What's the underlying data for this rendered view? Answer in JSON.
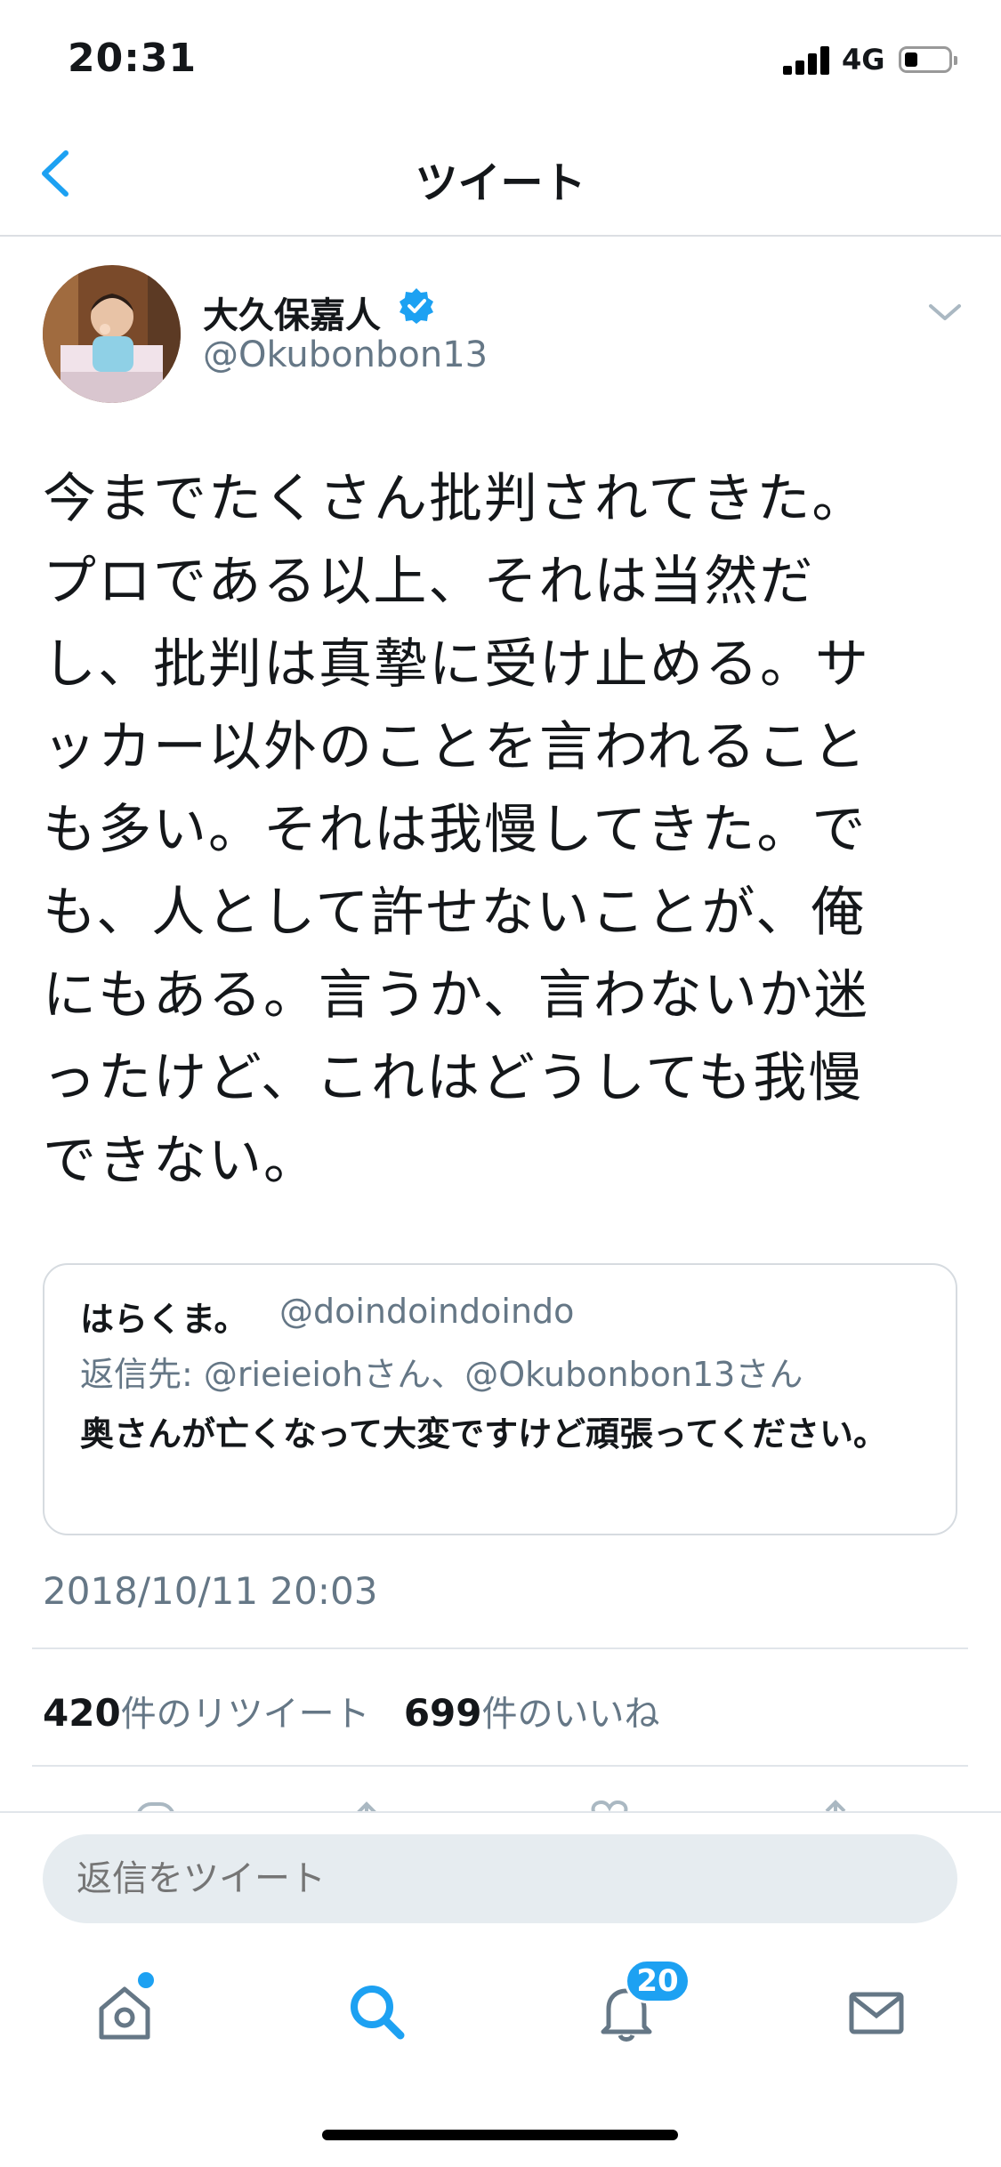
{
  "status_bar": {
    "time": "20:31",
    "network": "4G",
    "battery_level": 0.25
  },
  "nav": {
    "title": "ツイート",
    "back_icon": "chevron-left-icon"
  },
  "author": {
    "name": "大久保嘉人",
    "handle": "@Okubonbon13",
    "verified": true
  },
  "tweet": {
    "text": "今までたくさん批判されてきた。\nプロである以上、それは当然だ\nし、批判は真摯に受け止める。サ\nッカー以外のことを言われること\nも多い。それは我慢してきた。で\nも、人として許せないことが、俺\nにもある。言うか、言わないか迷\nったけど、これはどうしても我慢\nできない。",
    "timestamp": "2018/10/11 20:03"
  },
  "quoted": {
    "name": "はらくま。",
    "handle": "@doindoindoindo",
    "reply_to": "返信先: @rieieiohさん、@Okubonbon13さん",
    "text": "奥さんが亡くなって大変ですけど頑張ってください。"
  },
  "stats": {
    "retweets_count": "420",
    "retweets_label": "件のリツイート",
    "likes_count": "699",
    "likes_label": "件のいいね"
  },
  "reply": {
    "placeholder": "返信をツイート"
  },
  "tab_bar": {
    "items": [
      "home-icon",
      "search-icon",
      "bell-icon",
      "mail-icon"
    ],
    "notifications_badge": "20"
  },
  "colors": {
    "accent": "#1da1f2",
    "secondary_text": "#657786"
  }
}
